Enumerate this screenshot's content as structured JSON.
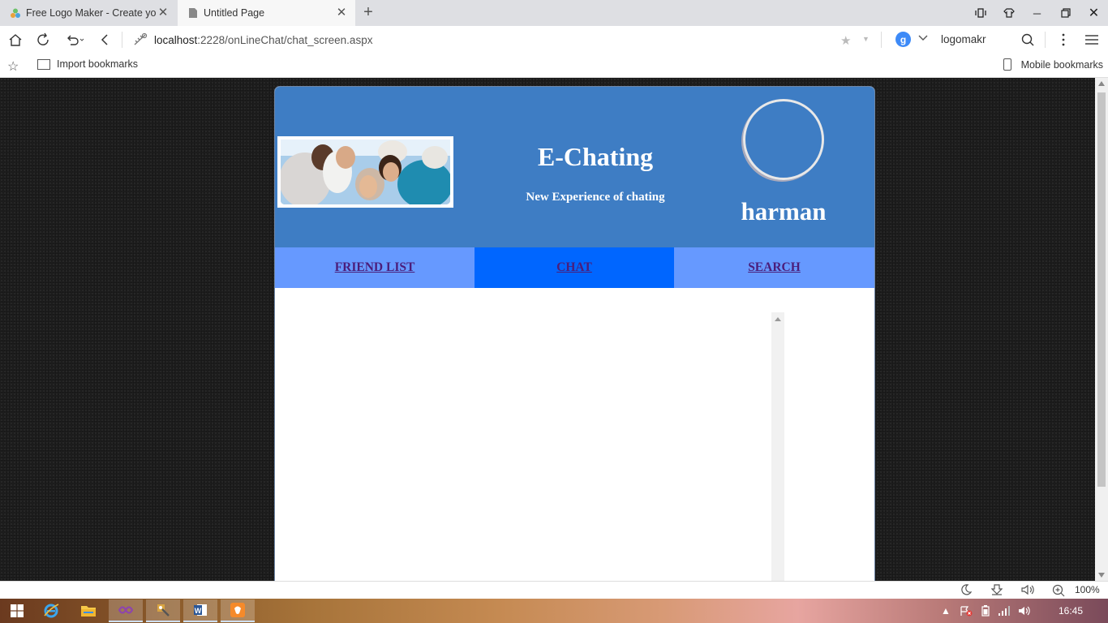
{
  "browser": {
    "tabs": [
      {
        "title": "Free Logo Maker - Create your"
      },
      {
        "title": "Untitled Page"
      }
    ],
    "url": {
      "host": "localhost",
      "rest": ":2228/onLineChat/chat_screen.aspx"
    },
    "search_engine_badge": "g",
    "search_text": "logomakr",
    "bookmarks": {
      "import_label": "Import bookmarks",
      "mobile_label": "Mobile bookmarks"
    },
    "zoom": "100%"
  },
  "app": {
    "title": "E-Chating",
    "subtitle": "New Experience of chating",
    "username": "harman",
    "menu": [
      {
        "label": "FRIEND LIST"
      },
      {
        "label": "CHAT"
      },
      {
        "label": "SEARCH"
      }
    ]
  },
  "taskbar": {
    "clock": "16:45"
  }
}
